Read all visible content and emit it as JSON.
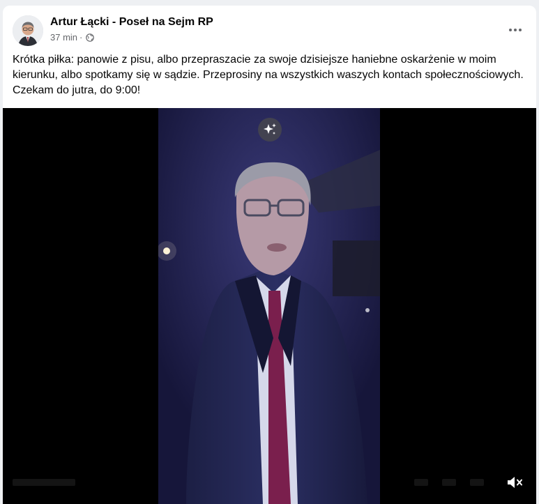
{
  "post": {
    "author": "Artur Łącki - Poseł na Sejm RP",
    "time": "37 min",
    "separator": "·",
    "privacy_icon": "globe-icon",
    "more_icon": "more-options-icon",
    "text": "Krótka piłka: panowie z pisu, albo przepraszacie za swoje dzisiejsze haniebne oskarżenie w moim kierunku, albo spotkamy się w sądzie. Przeprosiny na wszystkich waszych kontach społecznościowych. Czekam do jutra, do 9:00!"
  },
  "video": {
    "sparkle_icon": "sparkle-icon",
    "mute_icon": "speaker-muted-icon"
  },
  "colors": {
    "text": "#050505",
    "meta": "#65676b",
    "card": "#ffffff",
    "page": "#eef0f3",
    "video_bg": "#000000"
  }
}
